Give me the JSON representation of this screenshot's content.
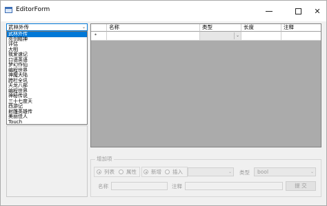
{
  "window": {
    "title": "EditorForm"
  },
  "controls": {
    "minimize": "—",
    "maximize": "□",
    "close": "✕"
  },
  "combo": {
    "value": "武林外传",
    "arrow": "⌄"
  },
  "list_items": [
    "武林外传",
    "亮剑精神",
    "评估",
    "大明",
    "我爱速记",
    "口语英语",
    "梦幻作仙",
    "编程世界",
    "神魔大陆",
    "跨栏全讯",
    "天龙八部",
    "编程世界",
    "神秘传说",
    "三十七度天",
    "西游记",
    "射雕英雄传",
    "美丽佳人",
    "Touch",
    "战三国"
  ],
  "grid": {
    "columns": [
      "名称",
      "类型",
      "长度",
      "注释"
    ],
    "new_row_marker": "*",
    "dropdown_arrow": "⌄"
  },
  "group": {
    "title": "增加项",
    "radios1": [
      {
        "label": "列表",
        "checked": true
      },
      {
        "label": "属性",
        "checked": false
      }
    ],
    "radios2": [
      {
        "label": "新增",
        "checked": true
      },
      {
        "label": "插入",
        "checked": false
      }
    ],
    "type_label": "类型",
    "type_value": "bool",
    "name_label": "名称",
    "comment_label": "注释",
    "submit_label": "提 交",
    "arrow": "⌄"
  }
}
